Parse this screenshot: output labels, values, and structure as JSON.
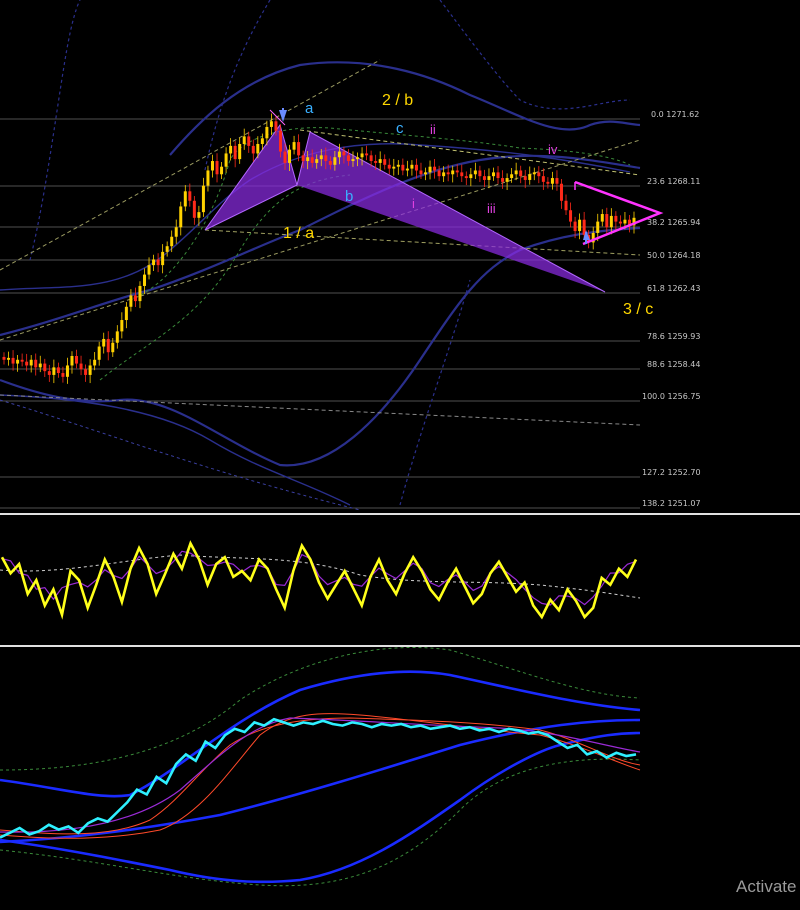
{
  "chart_data": [
    {
      "type": "candlestick",
      "panel": "main",
      "price_range": [
        1251.07,
        1271.62
      ],
      "fibonacci_levels": [
        {
          "level": "0.0",
          "price": "1271.62",
          "label": "0.0 1271.62"
        },
        {
          "level": "23.6",
          "price": "1268.11",
          "label": "23.6 1268.11"
        },
        {
          "level": "38.2",
          "price": "1265.94",
          "label": "38.2 1265.94"
        },
        {
          "level": "50.0",
          "price": "1264.18",
          "label": "50.0 1264.18"
        },
        {
          "level": "61.8",
          "price": "1262.43",
          "label": "61.8 1262.43"
        },
        {
          "level": "78.6",
          "price": "1259.93",
          "label": "78.6 1259.93"
        },
        {
          "level": "88.6",
          "price": "1258.44",
          "label": "88.6 1258.44"
        },
        {
          "level": "100.0",
          "price": "1256.75",
          "label": "100.0 1256.75"
        },
        {
          "level": "127.2",
          "price": "1252.70",
          "label": "127.2 1252.70"
        },
        {
          "level": "138.2",
          "price": "1251.07",
          "label": "138.2 1251.07"
        }
      ],
      "wave_labels": {
        "major": [
          "1 / a",
          "2 / b",
          "3 / c"
        ],
        "minor_abc": [
          "a",
          "b",
          "c"
        ],
        "roman": [
          "i",
          "ii",
          "iii",
          "iv"
        ]
      },
      "closes": [
        1258.9,
        1259.0,
        1258.7,
        1258.9,
        1258.8,
        1258.6,
        1258.9,
        1258.5,
        1258.7,
        1258.3,
        1258.1,
        1258.5,
        1258.2,
        1258.0,
        1258.6,
        1259.1,
        1258.7,
        1258.4,
        1258.1,
        1258.6,
        1258.9,
        1259.6,
        1260.0,
        1259.3,
        1259.8,
        1260.4,
        1261.0,
        1261.7,
        1262.3,
        1262.0,
        1262.8,
        1263.4,
        1263.9,
        1264.2,
        1263.9,
        1264.6,
        1264.9,
        1265.4,
        1265.9,
        1267.0,
        1267.8,
        1267.3,
        1266.4,
        1266.7,
        1268.1,
        1268.9,
        1269.4,
        1268.7,
        1269.1,
        1269.8,
        1270.2,
        1269.5,
        1270.3,
        1270.7,
        1270.2,
        1269.8,
        1270.3,
        1270.6,
        1271.2,
        1271.5,
        1271.0,
        1269.9,
        1269.3,
        1270.0,
        1270.4,
        1269.7,
        1269.4,
        1269.6,
        1269.3,
        1269.5,
        1269.7,
        1269.4,
        1269.2,
        1269.6,
        1269.9,
        1269.7,
        1269.4,
        1269.5,
        1269.6,
        1269.8,
        1269.7,
        1269.4,
        1269.3,
        1269.5,
        1269.2,
        1269.0,
        1269.1,
        1269.2,
        1268.9,
        1269.0,
        1269.2,
        1268.9,
        1268.7,
        1268.8,
        1269.1,
        1268.9,
        1268.6,
        1268.8,
        1268.7,
        1268.9,
        1268.8,
        1268.6,
        1268.5,
        1268.7,
        1268.9,
        1268.6,
        1268.4,
        1268.6,
        1268.8,
        1268.5,
        1268.3,
        1268.5,
        1268.7,
        1268.9,
        1268.6,
        1268.4,
        1268.7,
        1268.8,
        1268.6,
        1268.3,
        1268.2,
        1268.5,
        1268.2,
        1267.3,
        1266.8,
        1266.2,
        1265.7,
        1266.3,
        1265.5,
        1265.1,
        1265.6,
        1266.2,
        1266.6,
        1265.9,
        1266.5,
        1266.2,
        1266.1,
        1266.3,
        1266.0,
        1266.4
      ]
    },
    {
      "type": "line",
      "panel": "oscillator",
      "series": [
        {
          "values": [
            0.72,
            0.58,
            0.66,
            0.4,
            0.52,
            0.3,
            0.44,
            0.22,
            0.6,
            0.52,
            0.28,
            0.48,
            0.7,
            0.55,
            0.33,
            0.62,
            0.8,
            0.66,
            0.4,
            0.57,
            0.75,
            0.62,
            0.84,
            0.7,
            0.48,
            0.66,
            0.72,
            0.55,
            0.6,
            0.52,
            0.7,
            0.62,
            0.44,
            0.28,
            0.6,
            0.82,
            0.7,
            0.5,
            0.36,
            0.48,
            0.6,
            0.45,
            0.3,
            0.55,
            0.7,
            0.52,
            0.4,
            0.58,
            0.72,
            0.6,
            0.44,
            0.35,
            0.5,
            0.62,
            0.47,
            0.32,
            0.4,
            0.58,
            0.68,
            0.55,
            0.42,
            0.5,
            0.3,
            0.2,
            0.35,
            0.26,
            0.44,
            0.34,
            0.2,
            0.28,
            0.54,
            0.48,
            0.62,
            0.55,
            0.7
          ]
        }
      ]
    },
    {
      "type": "line",
      "panel": "indicator",
      "series": [
        {
          "values": [
            0.14,
            0.17,
            0.2,
            0.16,
            0.18,
            0.22,
            0.19,
            0.21,
            0.17,
            0.23,
            0.26,
            0.24,
            0.3,
            0.36,
            0.44,
            0.41,
            0.52,
            0.48,
            0.6,
            0.66,
            0.62,
            0.74,
            0.7,
            0.78,
            0.82,
            0.8,
            0.86,
            0.84,
            0.88,
            0.86,
            0.84,
            0.86,
            0.85,
            0.87,
            0.85,
            0.84,
            0.86,
            0.85,
            0.83,
            0.85,
            0.84,
            0.85,
            0.83,
            0.84,
            0.82,
            0.83,
            0.84,
            0.82,
            0.83,
            0.81,
            0.82,
            0.8,
            0.82,
            0.81,
            0.79,
            0.8,
            0.78,
            0.74,
            0.7,
            0.72,
            0.66,
            0.68,
            0.64,
            0.67,
            0.65,
            0.66
          ]
        }
      ]
    }
  ],
  "watermark": "Activate"
}
